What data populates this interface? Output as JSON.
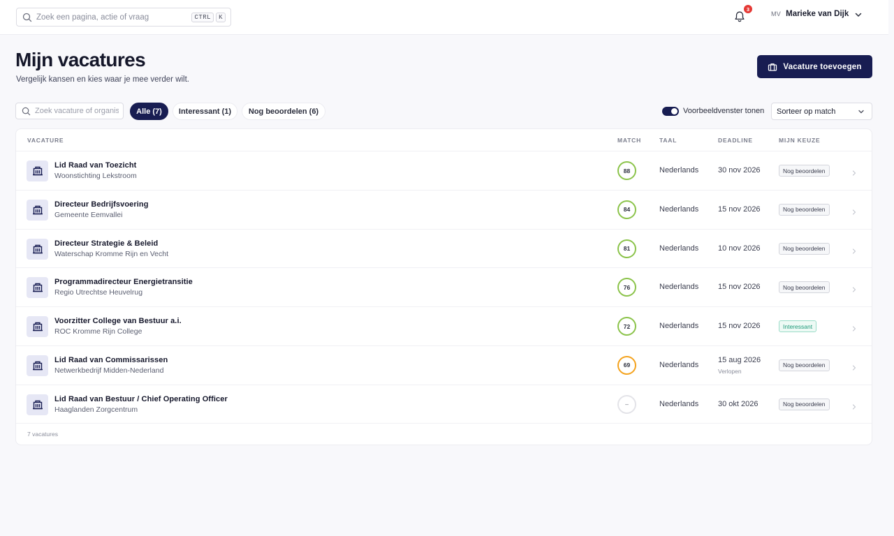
{
  "topbar": {
    "search_placeholder": "Zoek een pagina, actie of vraag",
    "kbd_ctrl": "CTRL",
    "kbd_k": "K",
    "notification_count": "3",
    "avatar_initials": "MV",
    "user_name": "Marieke van Dijk"
  },
  "header": {
    "title": "Mijn vacatures",
    "subtitle": "Vergelijk kansen en kies waar je mee verder wilt.",
    "add_button": "Vacature toevoegen"
  },
  "filters": {
    "search_placeholder": "Zoek vacature of organisatie",
    "chips": [
      {
        "label": "Alle (7)",
        "active": true
      },
      {
        "label": "Interessant (1)",
        "active": false
      },
      {
        "label": "Nog beoordelen (6)",
        "active": false
      }
    ],
    "preview_toggle_label": "Voorbeeldvenster tonen",
    "preview_toggle_on": true,
    "sort_value": "Sorteer op match"
  },
  "table": {
    "columns": {
      "vacature": "VACATURE",
      "match": "MATCH",
      "taal": "TAAL",
      "deadline": "DEADLINE",
      "keuze": "MIJN KEUZE"
    },
    "rows": [
      {
        "title": "Lid Raad van Toezicht",
        "org": "Woonstichting Lekstroom",
        "match": "88",
        "taal": "Nederlands",
        "deadline": "30 nov 2026",
        "note": "",
        "choice": "Nog beoordelen"
      },
      {
        "title": "Directeur Bedrijfsvoering",
        "org": "Gemeente Eemvallei",
        "match": "84",
        "taal": "Nederlands",
        "deadline": "15 nov 2026",
        "note": "",
        "choice": "Nog beoordelen"
      },
      {
        "title": "Directeur Strategie & Beleid",
        "org": "Waterschap Kromme Rijn en Vecht",
        "match": "81",
        "taal": "Nederlands",
        "deadline": "10 nov 2026",
        "note": "",
        "choice": "Nog beoordelen"
      },
      {
        "title": "Programmadirecteur Energietransitie",
        "org": "Regio Utrechtse Heuvelrug",
        "match": "76",
        "taal": "Nederlands",
        "deadline": "15 nov 2026",
        "note": "",
        "choice": "Nog beoordelen"
      },
      {
        "title": "Voorzitter College van Bestuur a.i.",
        "org": "ROC Kromme Rijn College",
        "match": "72",
        "taal": "Nederlands",
        "deadline": "15 nov 2026",
        "note": "",
        "choice": "Interessant"
      },
      {
        "title": "Lid Raad van Commissarissen",
        "org": "Netwerkbedrijf Midden-Nederland",
        "match": "69",
        "taal": "Nederlands",
        "deadline": "15 aug 2026",
        "note": "Verlopen",
        "choice": "Nog beoordelen"
      },
      {
        "title": "Lid Raad van Bestuur / Chief Operating Officer",
        "org": "Haaglanden Zorgcentrum",
        "match": "–",
        "taal": "Nederlands",
        "deadline": "30 okt 2026",
        "note": "",
        "choice": "Nog beoordelen"
      }
    ],
    "footer": "7 vacatures"
  },
  "colors": {
    "primary": "#181d52",
    "match_high": "#8bc34a",
    "match_mid": "#f4a21c",
    "interesting": "#1f9a7a",
    "badge": "#e53935"
  }
}
